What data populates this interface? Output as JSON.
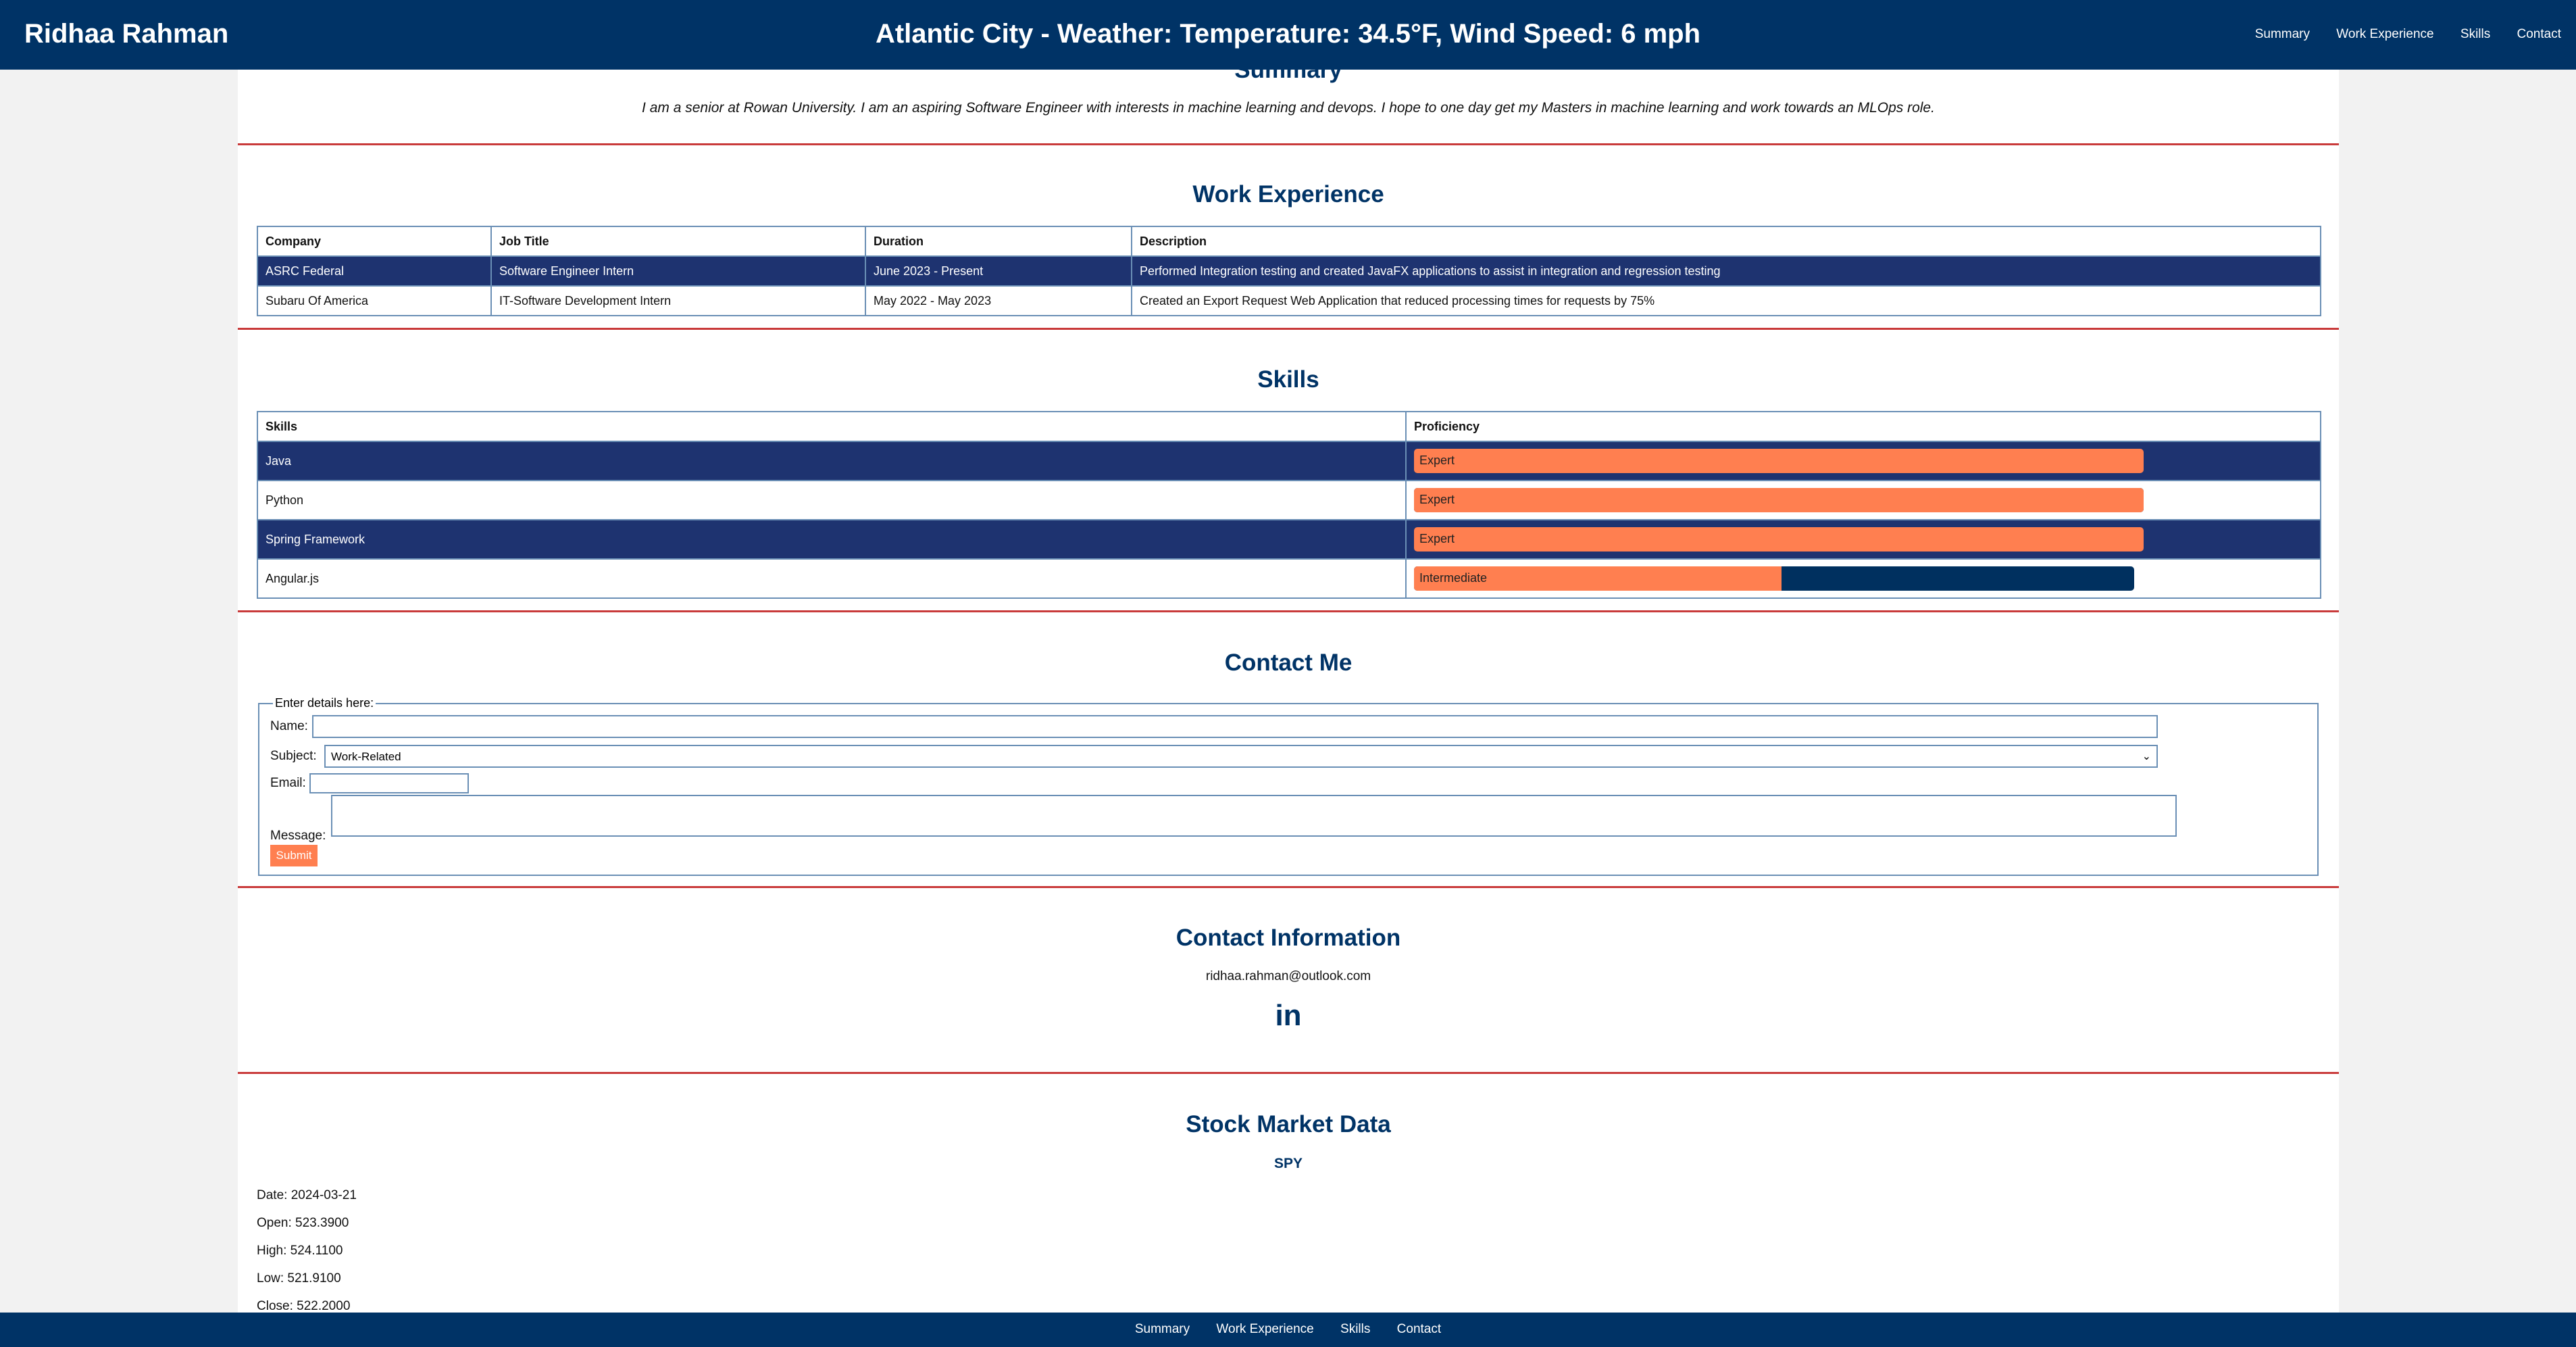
{
  "header": {
    "brand": "Ridhaa Rahman",
    "weather": "Atlantic City - Weather: Temperature: 34.5°F, Wind Speed: 6 mph",
    "nav": [
      "Summary",
      "Work Experience",
      "Skills",
      "Contact"
    ]
  },
  "summary": {
    "title": "Summary",
    "text": "I am a senior at Rowan University. I am an aspiring Software Engineer with interests in machine learning and devops. I hope to one day get my Masters in machine learning and work towards an MLOps role."
  },
  "work": {
    "title": "Work Experience",
    "headers": [
      "Company",
      "Job Title",
      "Duration",
      "Description"
    ],
    "rows": [
      [
        "ASRC Federal",
        "Software Engineer Intern",
        "June 2023 - Present",
        "Performed Integration testing and created JavaFX applications to assist in integration and regression testing"
      ],
      [
        "Subaru Of America",
        "IT-Software Development Intern",
        "May 2022 - May 2023",
        "Created an Export Request Web Application that reduced processing times for requests by 75%"
      ]
    ]
  },
  "skills": {
    "title": "Skills",
    "headers": [
      "Skills",
      "Proficiency"
    ],
    "rows": [
      {
        "name": "Java",
        "level": "Expert",
        "percent": 100
      },
      {
        "name": "Python",
        "level": "Expert",
        "percent": 100
      },
      {
        "name": "Spring Framework",
        "level": "Expert",
        "percent": 100
      },
      {
        "name": "Angular.js",
        "level": "Intermediate",
        "percent": 51
      }
    ],
    "bar_fill_color": "#ff7f50",
    "bar_track_color": "#00305f"
  },
  "contact_form": {
    "title": "Contact Me",
    "legend": "Enter details here:",
    "name_label": "Name:",
    "subject_label": "Subject:",
    "subject_value": "Work-Related",
    "email_label": "Email:",
    "message_label": "Message:",
    "submit_label": "Submit"
  },
  "contact_info": {
    "title": "Contact Information",
    "email": "ridhaa.rahman@outlook.com",
    "linkedin_icon": "linkedin-icon",
    "linkedin_text": "in"
  },
  "stock": {
    "title": "Stock Market Data",
    "symbol": "SPY",
    "date": "Date: 2024-03-21",
    "open": "Open: 523.3900",
    "high": "High: 524.1100",
    "low": "Low: 521.9100",
    "close": "Close: 522.2000"
  },
  "footer": {
    "nav": [
      "Summary",
      "Work Experience",
      "Skills",
      "Contact"
    ]
  },
  "colors": {
    "navy": "#003366",
    "accent": "#ff7f50",
    "divider": "#c93a3a",
    "highlight_row": "#1e3370"
  }
}
